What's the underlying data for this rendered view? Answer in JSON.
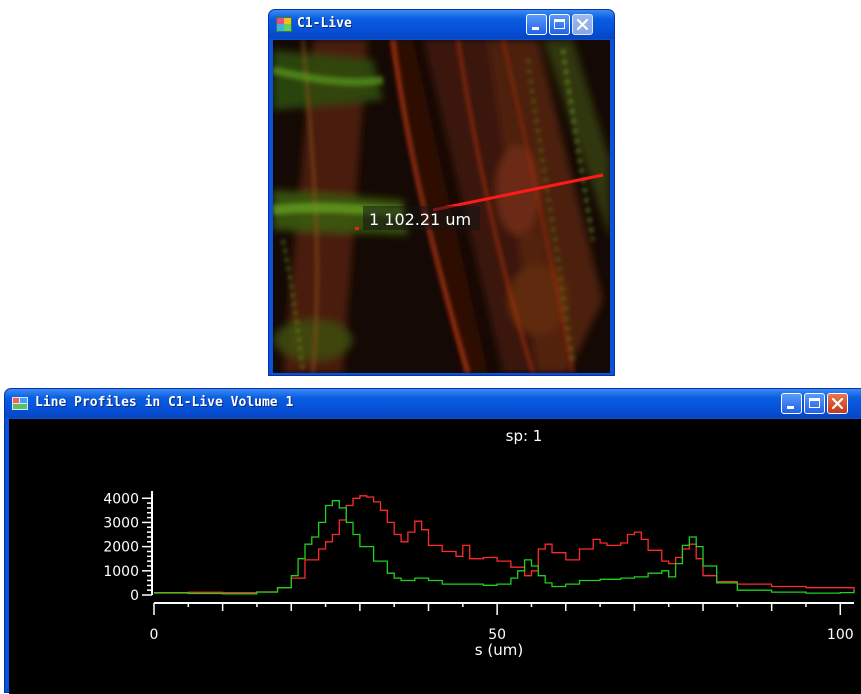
{
  "live_window": {
    "title": "C1-Live",
    "icon": "image-app-icon",
    "controls": [
      "minimize",
      "maximize",
      "close-disabled"
    ],
    "measurement_label": "1 102.21 um",
    "line_color": "#ff1a1a"
  },
  "profile_window": {
    "title": "Line Profiles in C1-Live Volume 1",
    "icon": "app-icon",
    "controls": [
      "minimize",
      "maximize",
      "close"
    ],
    "chart_data": {
      "type": "line",
      "title": "sp: 1",
      "xlabel": "s (um)",
      "ylabel": "",
      "xlim": [
        0,
        102
      ],
      "ylim": [
        0,
        4300
      ],
      "x_ticks": [
        "0",
        "50",
        "100"
      ],
      "y_ticks": [
        "4000",
        "3000",
        "2000",
        "1000",
        "0"
      ],
      "grid": false,
      "series": [
        {
          "color": "#ff2a2a",
          "x": [
            0,
            5,
            10,
            15,
            18,
            20,
            22,
            24,
            25,
            26,
            27,
            28,
            29,
            30,
            31,
            32,
            33,
            34,
            35,
            36,
            37,
            38,
            39,
            40,
            42,
            44,
            45,
            46,
            48,
            50,
            52,
            54,
            55,
            56,
            57,
            58,
            60,
            62,
            64,
            65,
            66,
            68,
            69,
            70,
            71,
            72,
            74,
            75,
            76,
            77,
            78,
            79,
            80,
            82,
            85,
            90,
            95,
            100,
            102
          ],
          "y": [
            80,
            110,
            100,
            130,
            300,
            700,
            1450,
            1900,
            2200,
            2500,
            3100,
            3700,
            4000,
            4100,
            4050,
            3850,
            3500,
            3000,
            2500,
            2200,
            2600,
            3050,
            2700,
            2050,
            1800,
            1600,
            2050,
            1500,
            1550,
            1400,
            1150,
            800,
            1000,
            1900,
            2100,
            1750,
            1450,
            1900,
            2300,
            2150,
            2050,
            2150,
            2500,
            2600,
            2300,
            1850,
            1400,
            1300,
            1550,
            1900,
            2100,
            1500,
            800,
            550,
            450,
            350,
            300,
            300,
            150
          ]
        },
        {
          "color": "#1ed21e",
          "x": [
            0,
            5,
            10,
            15,
            18,
            20,
            21,
            22,
            23,
            24,
            25,
            26,
            27,
            28,
            29,
            30,
            32,
            34,
            35,
            36,
            38,
            40,
            42,
            45,
            48,
            50,
            52,
            53,
            54,
            55,
            56,
            57,
            58,
            60,
            62,
            65,
            68,
            70,
            72,
            74,
            75,
            76,
            77,
            78,
            79,
            80,
            82,
            85,
            90,
            95,
            100,
            102
          ],
          "y": [
            100,
            60,
            50,
            120,
            300,
            800,
            1500,
            2100,
            2400,
            3000,
            3700,
            3900,
            3600,
            3000,
            2500,
            2000,
            1400,
            900,
            700,
            600,
            700,
            600,
            450,
            450,
            400,
            450,
            700,
            1000,
            1450,
            1200,
            800,
            500,
            350,
            450,
            600,
            650,
            700,
            750,
            900,
            1000,
            750,
            1300,
            2050,
            2400,
            2000,
            1200,
            500,
            200,
            120,
            80,
            100,
            200
          ]
        }
      ]
    }
  }
}
